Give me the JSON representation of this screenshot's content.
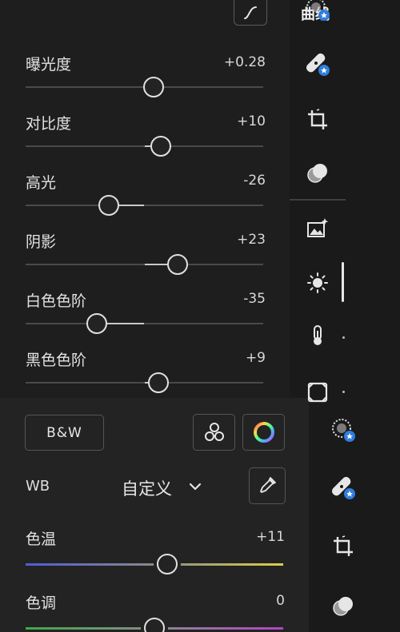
{
  "header": {
    "curves_label": "曲线",
    "curves_icon": "curve-icon"
  },
  "light": {
    "sliders": [
      {
        "key": "exposure",
        "label": "曝光度",
        "value": "+0.28",
        "level": 0.54
      },
      {
        "key": "contrast",
        "label": "对比度",
        "value": "+10",
        "level": 0.57
      },
      {
        "key": "highlights",
        "label": "高光",
        "value": "-26",
        "level": 0.35
      },
      {
        "key": "shadows",
        "label": "阴影",
        "value": "+23",
        "level": 0.64
      },
      {
        "key": "whites",
        "label": "白色色阶",
        "value": "-35",
        "level": 0.3
      },
      {
        "key": "blacks",
        "label": "黑色色阶",
        "value": "+9",
        "level": 0.56
      }
    ]
  },
  "color": {
    "bw_label": "B&W",
    "wb_label": "WB",
    "wb_value": "自定义",
    "temp_label": "色温",
    "temp_value": "+11",
    "temp_level": 0.55,
    "tint_label": "色调",
    "tint_value": "0",
    "tint_level": 0.5
  },
  "rail_top_icons": [
    "heal-icon",
    "bandage-icon",
    "crop-icon",
    "mask-icon",
    "auto-enhance-icon",
    "light-icon",
    "temperature-icon",
    "vignette-icon"
  ],
  "rail_bottom_icons": [
    "heal-icon",
    "bandage-icon",
    "crop-icon",
    "mask-icon"
  ],
  "colors": {
    "accent_badge": "#2f7de0",
    "temp_start": "#4f5bd6",
    "temp_end": "#d8cf4a",
    "tint_start": "#3fa84a",
    "tint_end": "#b044c8"
  }
}
